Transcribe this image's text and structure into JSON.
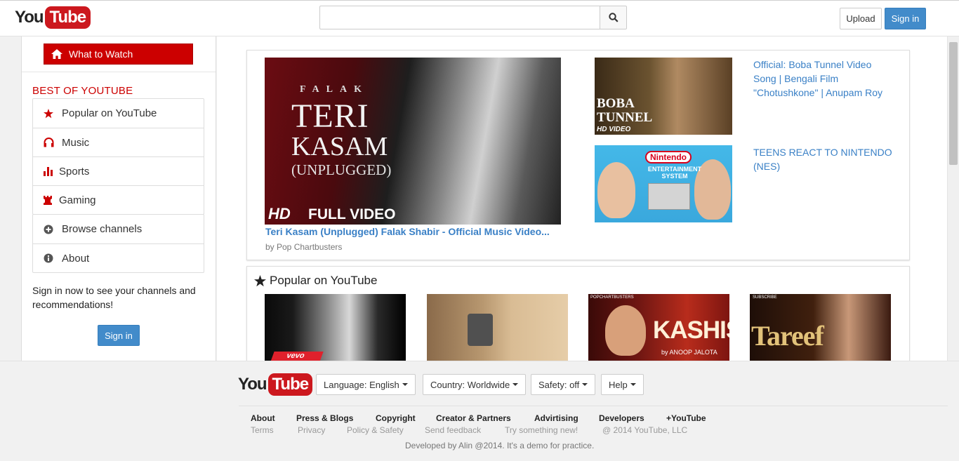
{
  "header": {
    "logo_you": "You",
    "logo_tube": "Tube",
    "search_placeholder": "",
    "upload_label": "Upload",
    "signin_label": "Sign in"
  },
  "sidebar": {
    "what_to_watch": "What to Watch",
    "section_title": "BEST OF YOUTUBE",
    "best_items": [
      {
        "label": "Popular on YouTube",
        "icon": "star-icon"
      },
      {
        "label": "Music",
        "icon": "headphones-icon"
      },
      {
        "label": "Sports",
        "icon": "bar-chart-icon"
      },
      {
        "label": "Gaming",
        "icon": "chess-rook-icon"
      }
    ],
    "other_items": [
      {
        "label": "Browse channels",
        "icon": "plus-circle-icon"
      },
      {
        "label": "About",
        "icon": "info-circle-icon"
      }
    ],
    "signin_prompt": "Sign in now to see your channels and recommendations!",
    "signin_label": "Sign in"
  },
  "featured": {
    "main": {
      "thumb_line1": "FALAK",
      "thumb_line2": "TERI",
      "thumb_line3": "KASAM",
      "thumb_line4": "(UNPLUGGED)",
      "thumb_hd": "HD",
      "thumb_fullvideo": "FULL VIDEO",
      "title": "Teri Kasam (Unplugged) Falak Shabir - Official Music Video...",
      "byline": "by Pop Chartbusters"
    },
    "side": [
      {
        "thumb_text1": "BOBA",
        "thumb_text2": "TUNNEL",
        "thumb_text3": "HD VIDEO",
        "title": "Official: Boba Tunnel Video Song | Bengali Film \"Chotushkone\" | Anupam Roy"
      },
      {
        "thumb_text1": "Nintendo",
        "thumb_text2": "ENTERTAINMENT SYSTEM",
        "title": "TEENS REACT TO NINTENDO (NES)"
      }
    ]
  },
  "popular": {
    "title": "Popular on YouTube",
    "thumbs": [
      {
        "text": "vevo"
      },
      {
        "text": ""
      },
      {
        "text": "KASHISH",
        "sub": "by ANOOP JALOTA",
        "corner": "POPCHARTBUSTERS"
      },
      {
        "text": "Tareef",
        "corner": "SUBSCRIBE"
      }
    ]
  },
  "footer": {
    "logo_you": "You",
    "logo_tube": "Tube",
    "dropdowns": [
      "Language: English",
      "Country: Worldwide",
      "Safety: off",
      "Help"
    ],
    "links": [
      "About",
      "Press & Blogs",
      "Copyright",
      "Creator & Partners",
      "Advirtising",
      "Developers",
      "+YouTube"
    ],
    "sub_links": [
      "Terms",
      "Privacy",
      "Policy & Safety",
      "Send feedback",
      "Try something new!",
      "@ 2014 YouTube, LLC"
    ],
    "developer_note": "Developed by Alin @2014. It's a demo for practice."
  },
  "colors": {
    "brand_red": "#cc181e",
    "accent_blue": "#428bca",
    "link_blue": "#3a80c6"
  }
}
